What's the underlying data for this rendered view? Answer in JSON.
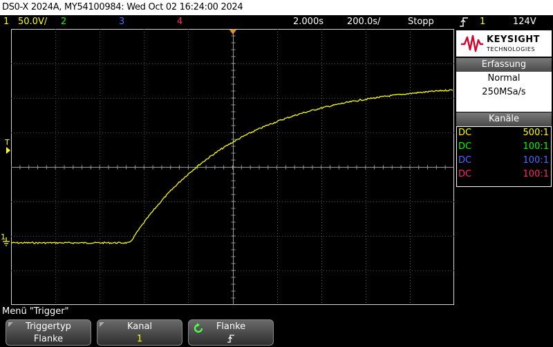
{
  "title": "DS0-X 2024A, MY54100984: Wed Oct 02 16:24:00 2024",
  "status": {
    "ch1_num": "1",
    "ch1_scale": "50.0V/",
    "ch2_num": "2",
    "ch3_num": "3",
    "ch4_num": "4",
    "time_delay": "2.000s",
    "time_scale": "200.0s/",
    "run_state": "Stopp",
    "trigger_icon": "rising-edge-icon",
    "trigger_source": "1",
    "trigger_level": "124V"
  },
  "colors": {
    "ch1": "#ffff00",
    "ch2": "#00ff00",
    "ch3": "#4a6dff",
    "ch4": "#ff2a6a",
    "trigger_marker": "#ff8c00"
  },
  "markers": {
    "trigger_level_label": "T",
    "ch1_ground_label": "1"
  },
  "panel": {
    "brand": "KEYSIGHT",
    "brand_sub": "TECHNOLOGIES",
    "acq_header": "Erfassung",
    "acq_mode": "Normal",
    "acq_rate": "250MSa/s",
    "channels_header": "Kanäle",
    "channels": [
      {
        "coupling": "DC",
        "probe": "500:1"
      },
      {
        "coupling": "DC",
        "probe": "100:1"
      },
      {
        "coupling": "DC",
        "probe": "100:1"
      },
      {
        "coupling": "DC",
        "probe": "100:1"
      }
    ]
  },
  "menu": {
    "title": "Menü \"Trigger\"",
    "softkeys": [
      {
        "label": "Triggertyp",
        "value": "Flanke"
      },
      {
        "label": "Kanal",
        "value": "1"
      },
      {
        "label": "Flanke",
        "value": "rising-edge"
      }
    ]
  }
}
